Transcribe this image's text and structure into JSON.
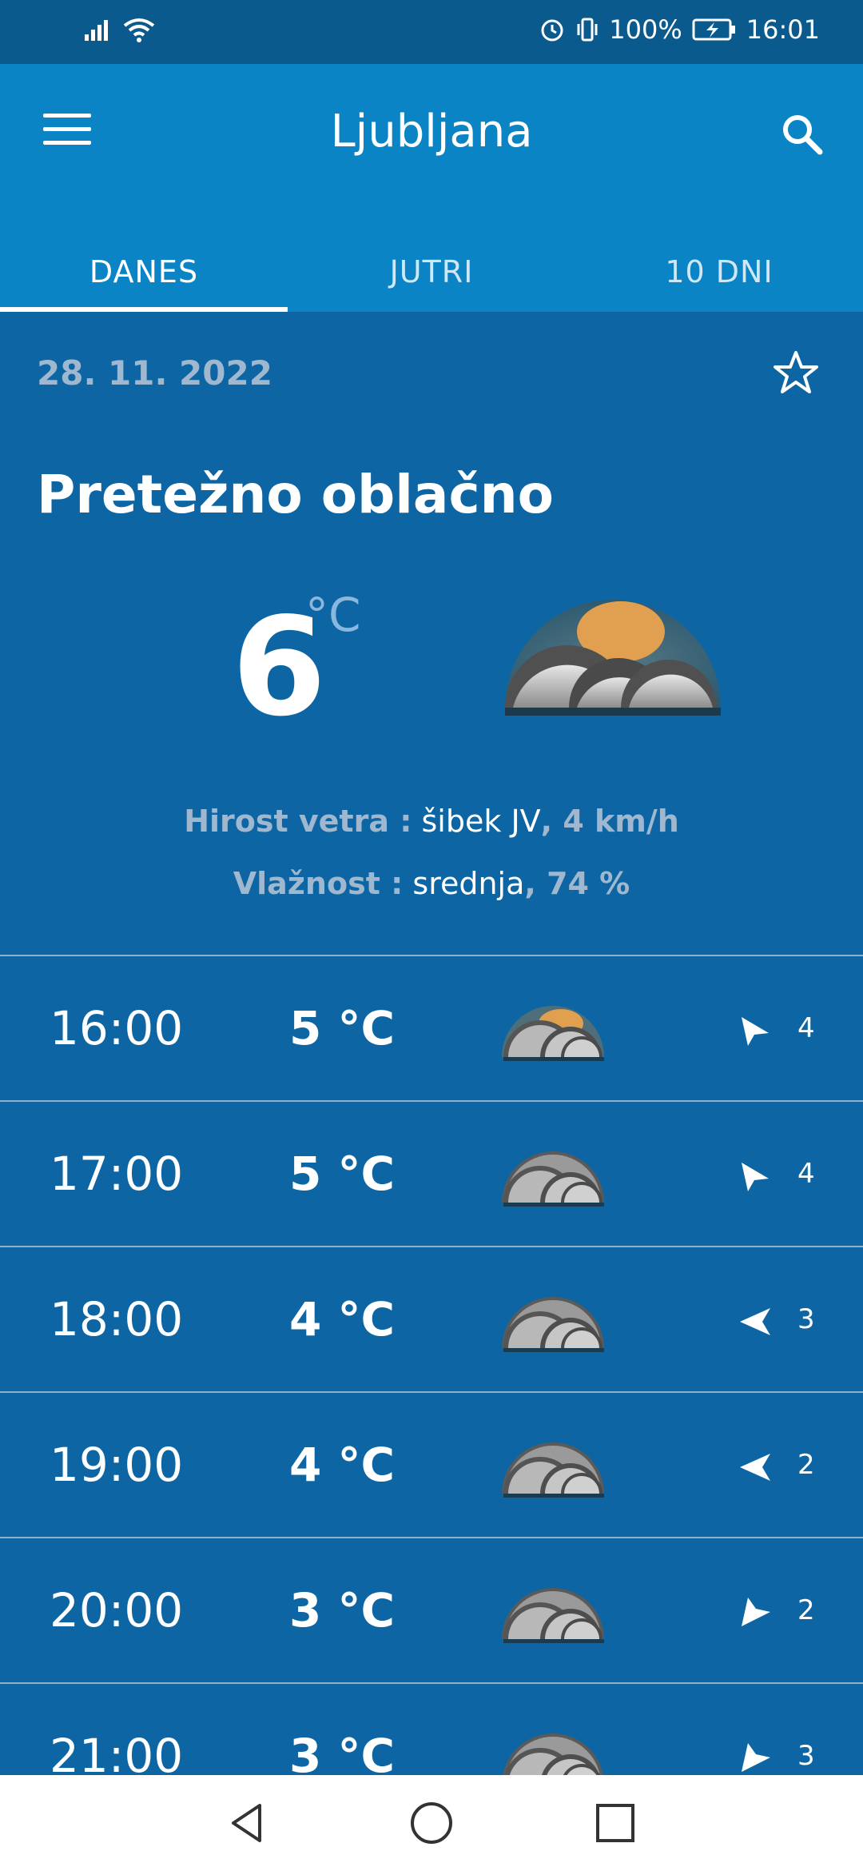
{
  "status": {
    "battery": "100%",
    "time": "16:01",
    "icons": [
      "signal-icon",
      "wifi-icon",
      "alarm-icon",
      "vibrate-icon",
      "battery-charging-icon"
    ]
  },
  "header": {
    "title": "Ljubljana",
    "menu_icon": "menu-icon",
    "search_icon": "search-icon"
  },
  "tabs": [
    {
      "label": "DANES",
      "active": true
    },
    {
      "label": "JUTRI",
      "active": false
    },
    {
      "label": "10 DNI",
      "active": false
    }
  ],
  "current": {
    "date": "28. 11. 2022",
    "condition": "Pretežno oblačno",
    "temperature": "6",
    "unit": "°C",
    "wind_label": "Hirost vetra :",
    "wind_value": "šibek JV",
    "wind_speed": ", 4 km/h",
    "humidity_label": "Vlažnost :",
    "humidity_value": "srednja",
    "humidity_percent": ", 74 %",
    "icon": "partly-cloudy-icon"
  },
  "hourly": [
    {
      "time": "16:00",
      "temp": "5 °C",
      "icon": "partly-cloudy-icon",
      "wind_speed": "4",
      "wind_dir": "arrow-down-right"
    },
    {
      "time": "17:00",
      "temp": "5 °C",
      "icon": "cloudy-icon",
      "wind_speed": "4",
      "wind_dir": "arrow-down-right"
    },
    {
      "time": "18:00",
      "temp": "4 °C",
      "icon": "cloudy-icon",
      "wind_speed": "3",
      "wind_dir": "arrow-left"
    },
    {
      "time": "19:00",
      "temp": "4 °C",
      "icon": "cloudy-icon",
      "wind_speed": "2",
      "wind_dir": "arrow-left"
    },
    {
      "time": "20:00",
      "temp": "3 °C",
      "icon": "cloudy-icon",
      "wind_speed": "2",
      "wind_dir": "arrow-up-right"
    },
    {
      "time": "21:00",
      "temp": "3 °C",
      "icon": "cloudy-icon",
      "wind_speed": "3",
      "wind_dir": "arrow-up-right"
    }
  ],
  "nav": {
    "back_icon": "back-icon",
    "home_icon": "home-icon",
    "recents_icon": "recents-icon"
  }
}
